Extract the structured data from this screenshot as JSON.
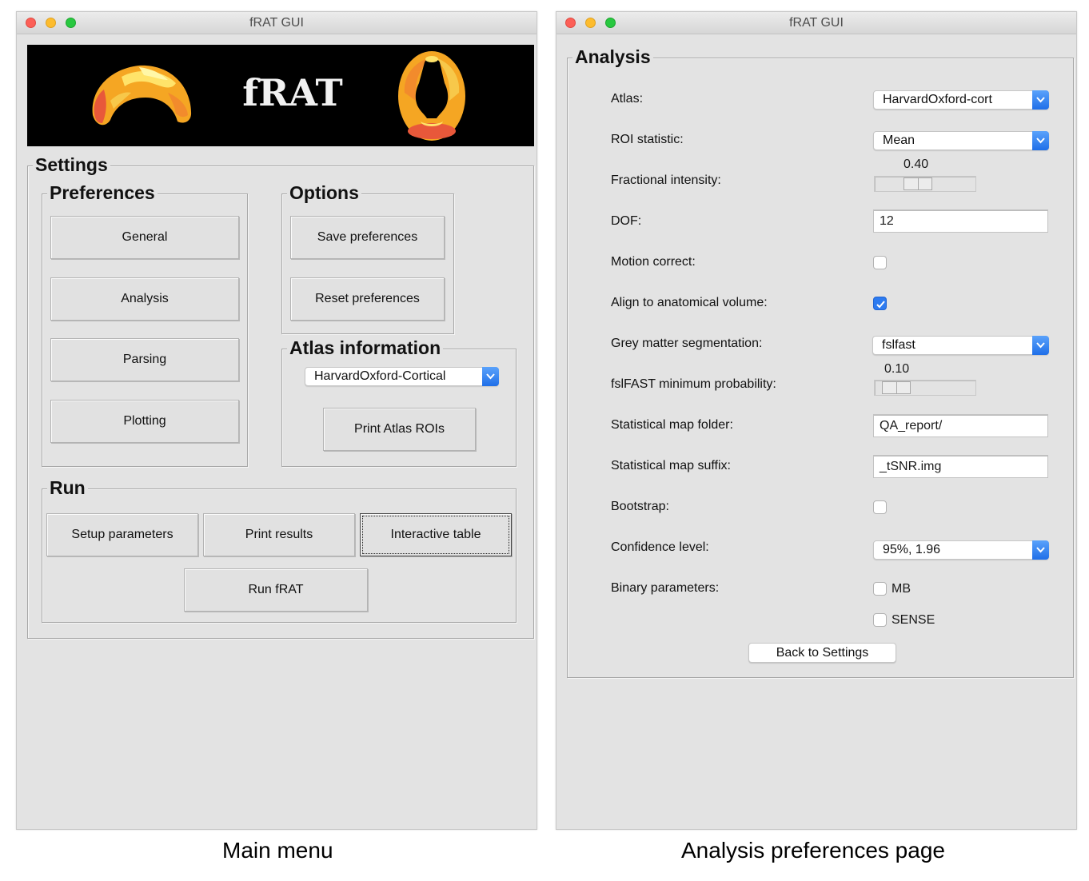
{
  "main_window": {
    "title": "fRAT GUI",
    "banner_text": "fRAT",
    "settings_label": "Settings",
    "preferences": {
      "label": "Preferences",
      "buttons": [
        "General",
        "Analysis",
        "Parsing",
        "Plotting"
      ]
    },
    "options": {
      "label": "Options",
      "save_label": "Save preferences",
      "reset_label": "Reset preferences"
    },
    "atlas_information": {
      "label": "Atlas information",
      "selected_atlas": "HarvardOxford-Cortical",
      "print_label": "Print Atlas ROIs"
    },
    "run": {
      "label": "Run",
      "setup_label": "Setup parameters",
      "print_results_label": "Print results",
      "interactive_table_label": "Interactive table",
      "run_label": "Run fRAT"
    }
  },
  "analysis_window": {
    "title": "fRAT GUI",
    "group_label": "Analysis",
    "atlas": {
      "label": "Atlas:",
      "value": "HarvardOxford-cort"
    },
    "roi_statistic": {
      "label": "ROI statistic:",
      "value": "Mean"
    },
    "fractional_intensity": {
      "label": "Fractional intensity:",
      "value": "0.40",
      "level": 0.4
    },
    "dof": {
      "label": "DOF:",
      "value": "12"
    },
    "motion_correct": {
      "label": "Motion correct:",
      "checked": false
    },
    "align_anatomical": {
      "label": "Align to anatomical volume:",
      "checked": true
    },
    "grey_matter": {
      "label": "Grey matter segmentation:",
      "value": "fslfast"
    },
    "fslfast_min_prob": {
      "label": "fslFAST minimum probability:",
      "value": "0.10",
      "level": 0.1
    },
    "stat_map_folder": {
      "label": "Statistical map folder:",
      "value": "QA_report/"
    },
    "stat_map_suffix": {
      "label": "Statistical map suffix:",
      "value": "_tSNR.img"
    },
    "bootstrap": {
      "label": "Bootstrap:",
      "checked": false
    },
    "confidence_level": {
      "label": "Confidence level:",
      "value": "95%, 1.96"
    },
    "binary_parameters": {
      "label": "Binary parameters:",
      "options": [
        {
          "label": "MB",
          "checked": false
        },
        {
          "label": "SENSE",
          "checked": false
        }
      ]
    },
    "back_label": "Back to Settings"
  },
  "captions": {
    "left": "Main menu",
    "right": "Analysis preferences page"
  },
  "colors": {
    "window_bg": "#e3e3e3",
    "accent_blue": "#2d7bf0",
    "banner_bg": "#000000",
    "brain_orange": "#f5a623",
    "brain_yellow": "#ffe36a",
    "brain_red": "#e8583a"
  }
}
